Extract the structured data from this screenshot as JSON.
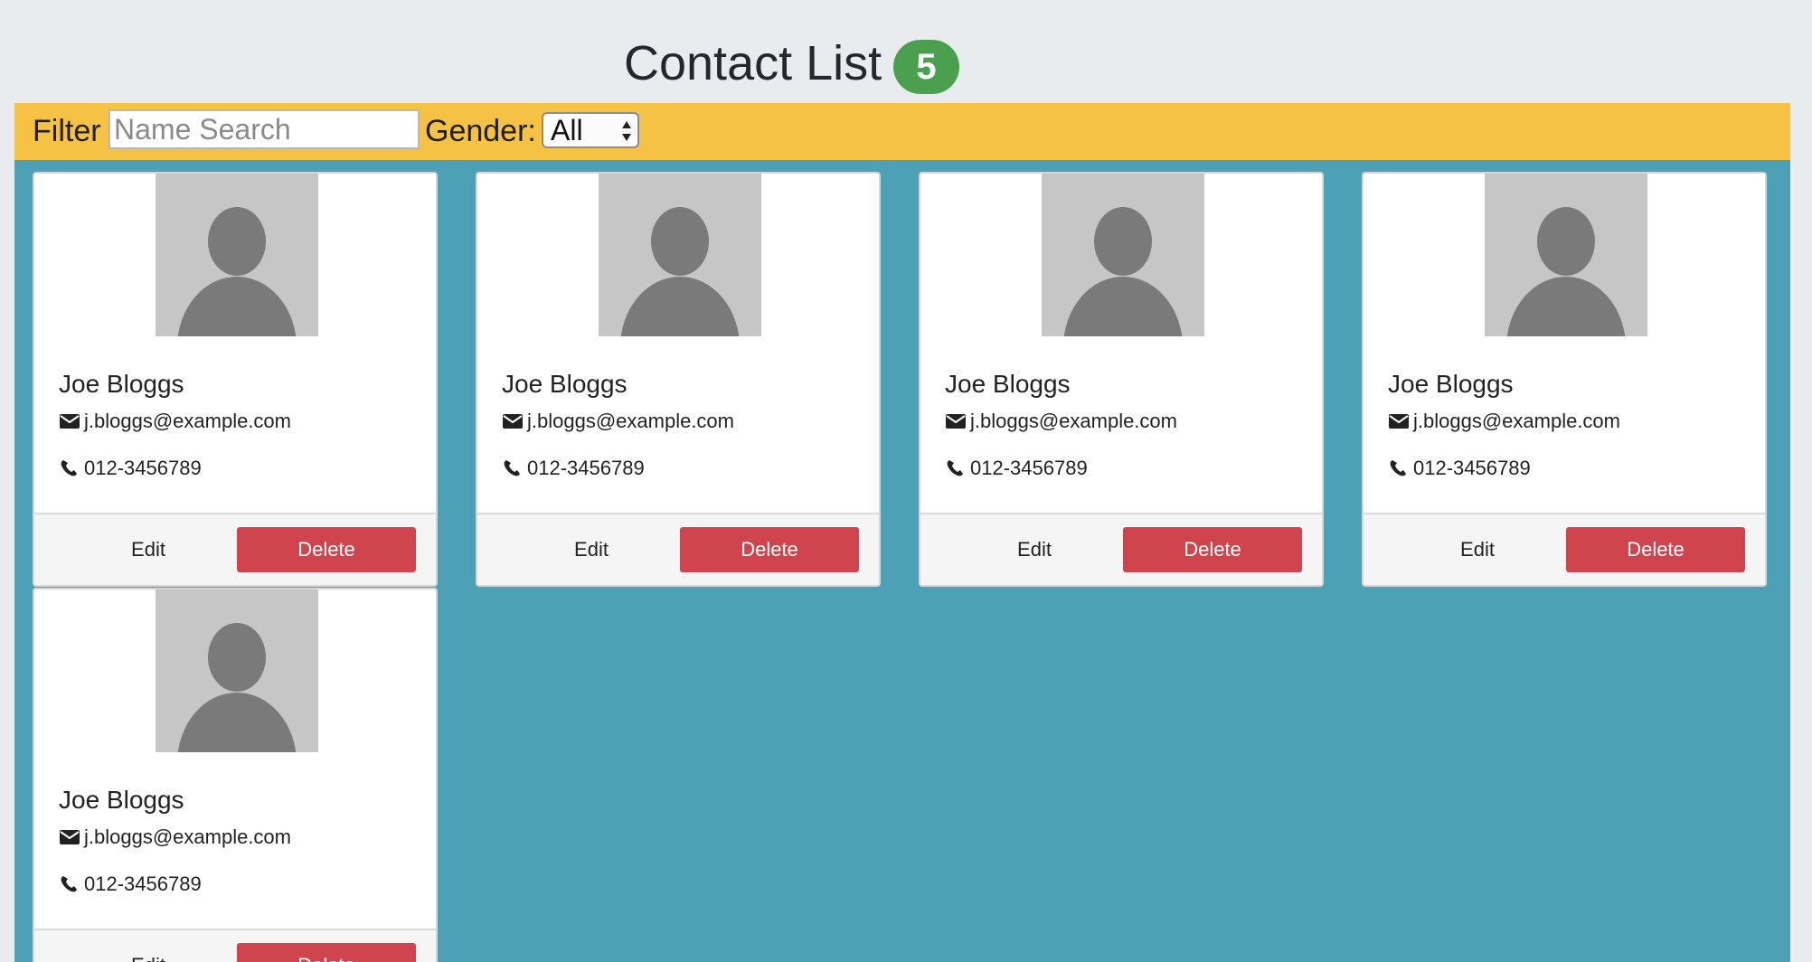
{
  "header": {
    "title": "Contact List",
    "count": "5"
  },
  "filter": {
    "label": "Filter",
    "name_placeholder": "Name Search",
    "name_value": "",
    "gender_label": "Gender:",
    "gender_selected": "All"
  },
  "colors": {
    "page_bg": "#e8ecef",
    "badge": "#4aa04e",
    "filter_bar": "#f5c244",
    "contacts_bg": "#4ca1b6",
    "delete": "#cf444d"
  },
  "contacts": [
    {
      "name": "Joe Bloggs",
      "email": "j.bloggs@example.com",
      "phone": "012-3456789",
      "avatar": "person-silhouette-icon",
      "edit_label": "Edit",
      "delete_label": "Delete"
    },
    {
      "name": "Joe Bloggs",
      "email": "j.bloggs@example.com",
      "phone": "012-3456789",
      "avatar": "person-silhouette-icon",
      "edit_label": "Edit",
      "delete_label": "Delete"
    },
    {
      "name": "Joe Bloggs",
      "email": "j.bloggs@example.com",
      "phone": "012-3456789",
      "avatar": "person-silhouette-icon",
      "edit_label": "Edit",
      "delete_label": "Delete"
    },
    {
      "name": "Joe Bloggs",
      "email": "j.bloggs@example.com",
      "phone": "012-3456789",
      "avatar": "person-silhouette-icon",
      "edit_label": "Edit",
      "delete_label": "Delete"
    },
    {
      "name": "Joe Bloggs",
      "email": "j.bloggs@example.com",
      "phone": "012-3456789",
      "avatar": "person-silhouette-icon",
      "edit_label": "Edit",
      "delete_label": "Delete"
    }
  ],
  "icons": {
    "email": "envelope-icon",
    "phone": "phone-icon",
    "select": "select-arrows-icon"
  }
}
